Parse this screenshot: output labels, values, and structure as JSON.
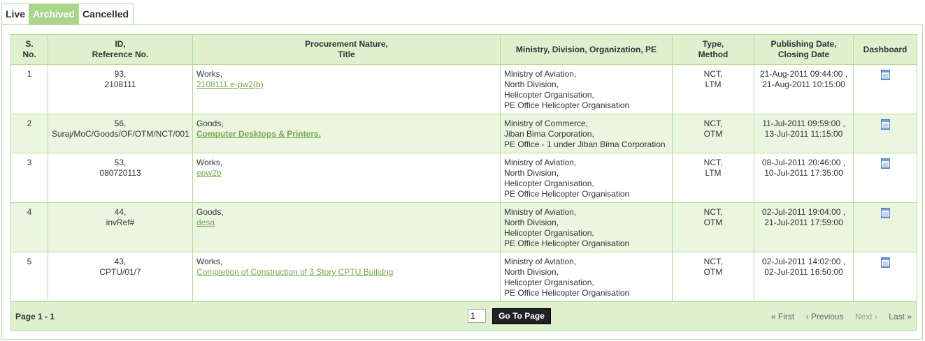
{
  "tabs": [
    "Live",
    "Archived",
    "Cancelled"
  ],
  "table": {
    "headers": {
      "sno": [
        "S.",
        "No."
      ],
      "id": [
        "ID,",
        "Reference No."
      ],
      "nature": [
        "Procurement Nature,",
        "Title"
      ],
      "ministry": "Ministry, Division, Organization, PE",
      "type": [
        "Type,",
        "Method"
      ],
      "dates": [
        "Publishing Date,",
        "Closing Date"
      ],
      "dashboard": "Dashboard"
    },
    "rows": [
      {
        "sno": "1",
        "id": "93,",
        "ref": "2108111",
        "nature": "Works,",
        "title": "2108111 e-pw2(b)",
        "title_bold": false,
        "ministry": [
          "Ministry of Aviation,",
          "North Division,",
          "Helicopter Organisation,",
          "PE Office Helicopter Organisation"
        ],
        "type": "NCT,",
        "method": "LTM",
        "publish": "21-Aug-2011 09:44:00 ,",
        "close": "21-Aug-2011 10:15:00"
      },
      {
        "sno": "2",
        "id": "56,",
        "ref": "Suraj/MoC/Goods/OF/OTM/NCT/001",
        "nature": "Goods,",
        "title": "Computer Desktops & Printers.",
        "title_bold": true,
        "ministry": [
          "Ministry of Commerce,",
          "Jiban Bima Corporation,",
          "PE Office - 1 under Jiban Bima Corporation"
        ],
        "type": "NCT,",
        "method": "OTM",
        "publish": "11-Jul-2011 09:59:00 ,",
        "close": "13-Jul-2011 11:15:00"
      },
      {
        "sno": "3",
        "id": "53,",
        "ref": "080720113",
        "nature": "Works,",
        "title": "epw2b",
        "title_bold": false,
        "ministry": [
          "Ministry of Aviation,",
          "North Division,",
          "Helicopter Organisation,",
          "PE Office Helicopter Organisation"
        ],
        "type": "NCT,",
        "method": "LTM",
        "publish": "08-Jul-2011 20:46:00 ,",
        "close": "10-Jul-2011 17:35:00"
      },
      {
        "sno": "4",
        "id": "44,",
        "ref": "invRef#",
        "nature": "Goods,",
        "title": "desa",
        "title_bold": false,
        "ministry": [
          "Ministry of Aviation,",
          "North Division,",
          "Helicopter Organisation,",
          "PE Office Helicopter Organisation"
        ],
        "type": "NCT,",
        "method": "OTM",
        "publish": "02-Jul-2011 19:04:00 ,",
        "close": "21-Jul-2011 17:59:00"
      },
      {
        "sno": "5",
        "id": "43,",
        "ref": "CPTU/01/7",
        "nature": "Works,",
        "title": "Completion of Construction of 3 Story CPTU Builidng",
        "title_bold": false,
        "ministry": [
          "Ministry of Aviation,",
          "North Division,",
          "Helicopter Organisation,",
          "PE Office Helicopter Organisation"
        ],
        "type": "NCT,",
        "method": "OTM",
        "publish": "02-Jul-2011 14:02:00 ,",
        "close": "02-Jul-2011 16:50:00"
      }
    ]
  },
  "pager": {
    "label": "Page",
    "range": "1 - 1",
    "page_value": "1",
    "go_label": "Go To Page",
    "first": "« First",
    "previous": "‹ Previous",
    "next": "Next ›",
    "last": "Last »"
  },
  "colors": {
    "accent": "#a9d68b",
    "header_bg": "#dff0cf",
    "row_alt": "#eaf6e0",
    "border": "#b5dc9a",
    "link": "#77a84f"
  },
  "icons": {
    "dashboard": "document-icon"
  }
}
